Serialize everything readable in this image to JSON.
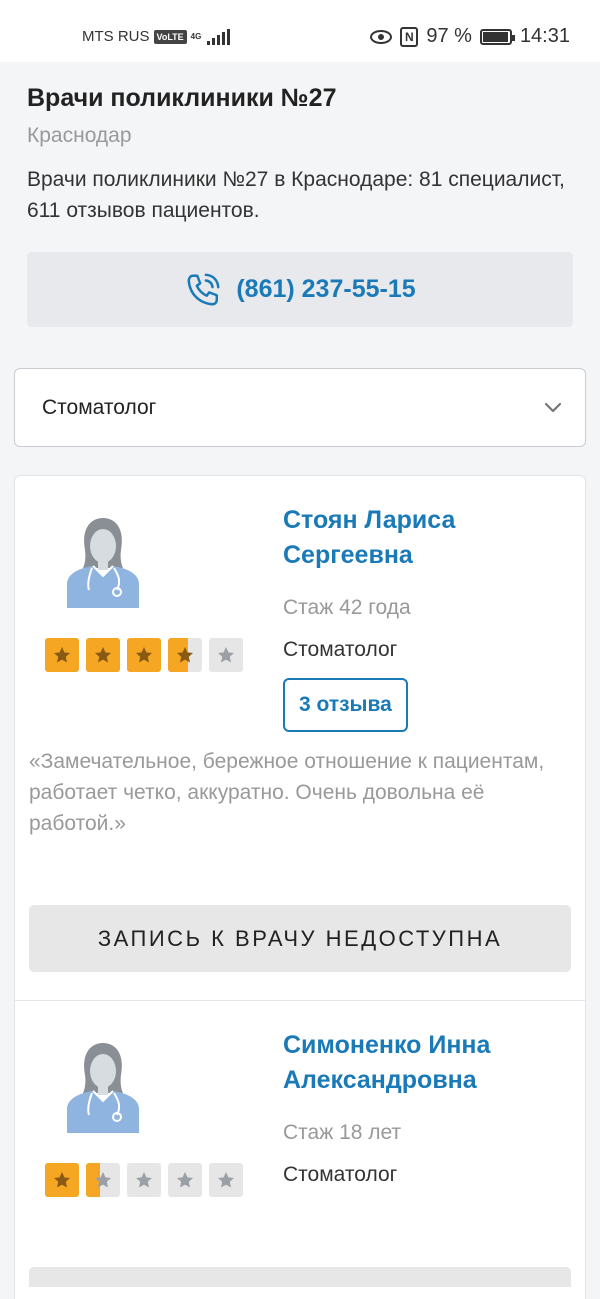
{
  "status_bar": {
    "carrier": "MTS RUS",
    "volte": "VoLTE",
    "network": "4G",
    "battery": "97 %",
    "battery_level": 0.97,
    "time": "14:31"
  },
  "header": {
    "title": "Врачи поликлиники №27",
    "city": "Краснодар",
    "description": "Врачи поликлиники №27 в Краснодаре: 81 специалист, 611 отзывов пациентов."
  },
  "phone": {
    "number": "(861) 237-55-15",
    "icon": "phone-ringing-icon"
  },
  "filter": {
    "selected": "Стоматолог"
  },
  "colors": {
    "accent": "#1a7ab8",
    "star": "#f5a623",
    "star_empty": "#e6e6e6"
  },
  "doctors": [
    {
      "name": "Стоян Лариса Сергеевна",
      "experience": "Стаж 42 года",
      "specialty": "Стоматолог",
      "rating": 3.6,
      "reviews": "3 отзыва",
      "quote": "«Замечательное, бережное отношение к пациентам, работает четко, аккуратно. Очень довольна её работой.»",
      "booking": "ЗАПИСЬ К ВРАЧУ НЕДОСТУПНА"
    },
    {
      "name": "Симоненко Инна Александровна",
      "experience": "Стаж 18 лет",
      "specialty": "Стоматолог",
      "rating": 1.4
    }
  ]
}
